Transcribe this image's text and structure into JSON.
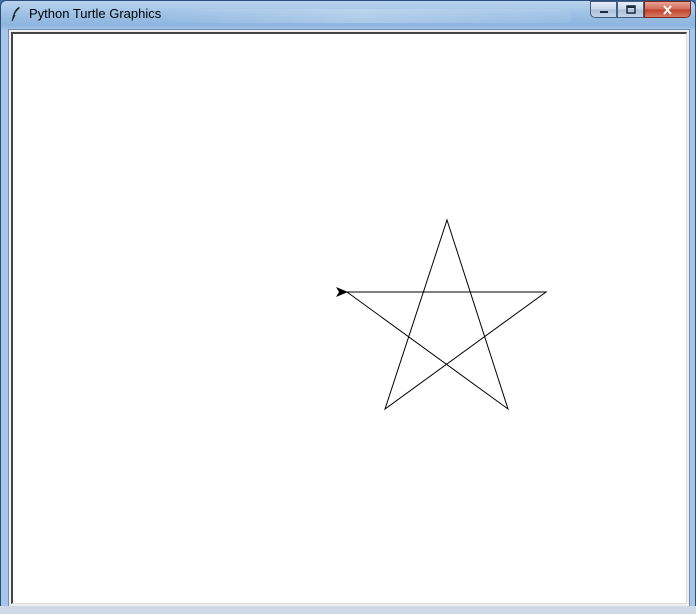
{
  "window": {
    "title": "Python Turtle Graphics",
    "icon": "feather-icon",
    "controls": [
      "minimize-icon",
      "maximize-icon",
      "close-icon"
    ]
  },
  "canvas": {
    "background": "#ffffff",
    "pen_color": "#000000",
    "drawing": "five-pointed star",
    "turtle_shape": "arrow"
  }
}
